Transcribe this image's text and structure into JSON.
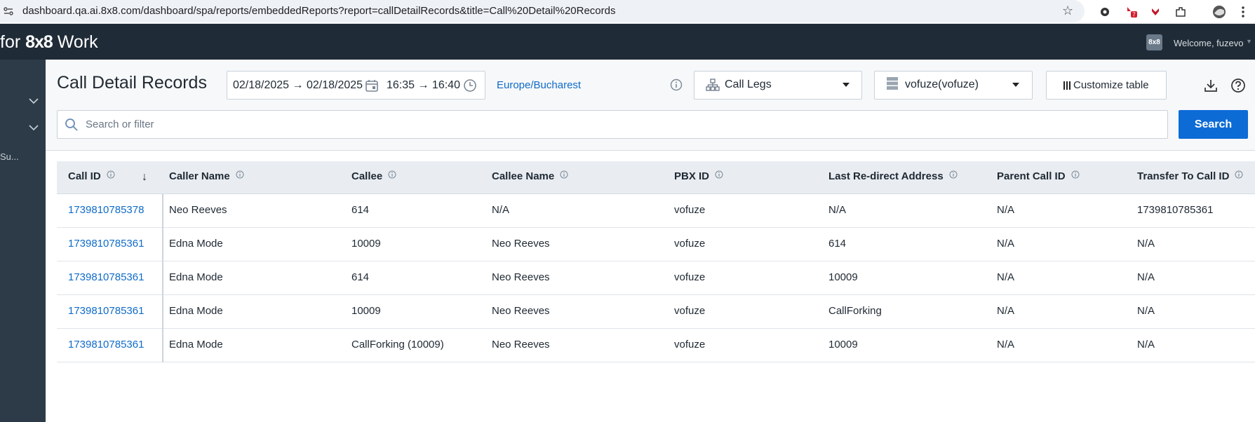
{
  "browser": {
    "url": "dashboard.qa.ai.8x8.com/dashboard/spa/reports/embeddedReports?report=callDetailRecords&title=Call%20Detail%20Records",
    "badge_count": "7"
  },
  "appbar": {
    "brand_prefix": "for ",
    "brand_name": "8x8",
    "brand_suffix": " Work",
    "logo_text": "8x8",
    "welcome": "Welcome, fuzevo"
  },
  "sidebar": {
    "truncated_label": "Su..."
  },
  "header": {
    "title": "Call Detail Records",
    "date_range": "02/18/2025 → 02/18/2025",
    "time_range": "16:35 → 16:40",
    "timezone": "Europe/Bucharest",
    "call_legs_label": "Call Legs",
    "account_label": "vofuze(vofuze)",
    "customize_label": "Customize table",
    "search_placeholder": "Search or filter",
    "search_button": "Search"
  },
  "table": {
    "columns": [
      "Call ID",
      "Caller Name",
      "Callee",
      "Callee Name",
      "PBX ID",
      "Last Re-direct Address",
      "Parent Call ID",
      "Transfer To Call ID"
    ],
    "rows": [
      [
        "1739810785378",
        "Neo Reeves",
        "614",
        "N/A",
        "vofuze",
        "N/A",
        "N/A",
        "1739810785361"
      ],
      [
        "1739810785361",
        "Edna Mode",
        "10009",
        "Neo Reeves",
        "vofuze",
        "614",
        "N/A",
        "N/A"
      ],
      [
        "1739810785361",
        "Edna Mode",
        "614",
        "Neo Reeves",
        "vofuze",
        "10009",
        "N/A",
        "N/A"
      ],
      [
        "1739810785361",
        "Edna Mode",
        "10009",
        "Neo Reeves",
        "vofuze",
        "CallForking",
        "N/A",
        "N/A"
      ],
      [
        "1739810785361",
        "Edna Mode",
        "CallForking (10009)",
        "Neo Reeves",
        "vofuze",
        "10009",
        "N/A",
        "N/A"
      ]
    ]
  },
  "colors": {
    "accent": "#0d6bd6",
    "link": "#0f6bc9",
    "appbar": "#1f2b36",
    "sidebar": "#2d3b48"
  }
}
